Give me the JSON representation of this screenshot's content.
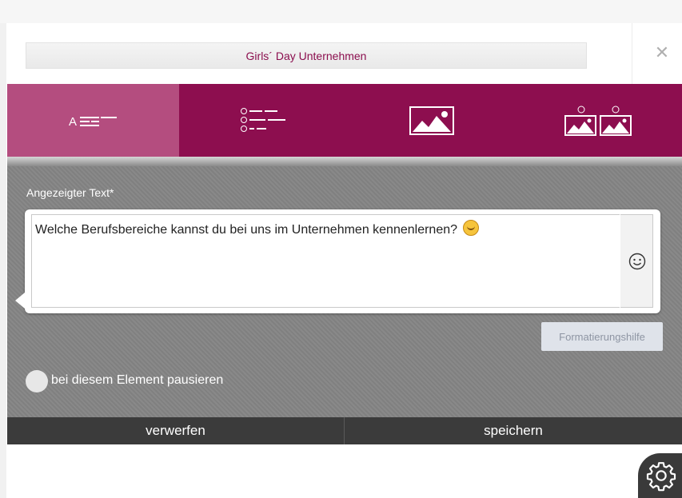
{
  "header": {
    "title": "Girls´ Day Unternehmen",
    "close_icon": "close-icon"
  },
  "tabs": [
    {
      "name": "text",
      "icon": "text-format-icon",
      "active": true
    },
    {
      "name": "list",
      "icon": "abc-list-icon",
      "active": false
    },
    {
      "name": "image",
      "icon": "image-icon",
      "active": false
    },
    {
      "name": "image-choice",
      "icon": "image-choice-icon",
      "active": false
    }
  ],
  "form": {
    "text_label": "Angezeigter Text*",
    "text_value": "Welche Berufsbereiche kannst du bei uns im Unternehmen kennenlernen?",
    "emoji_icon": "smiley-icon",
    "format_help": "Formatierungshilfe",
    "pause_label": "bei diesem Element pausieren",
    "pause_checked": false
  },
  "footer": {
    "discard": "verwerfen",
    "save": "speichern"
  },
  "settings_icon": "gear-icon",
  "colors": {
    "brand": "#8d0e4f",
    "tab_active": "#b44d7f",
    "form_bg": "#858585",
    "footer_bg": "#3b3b3b"
  }
}
